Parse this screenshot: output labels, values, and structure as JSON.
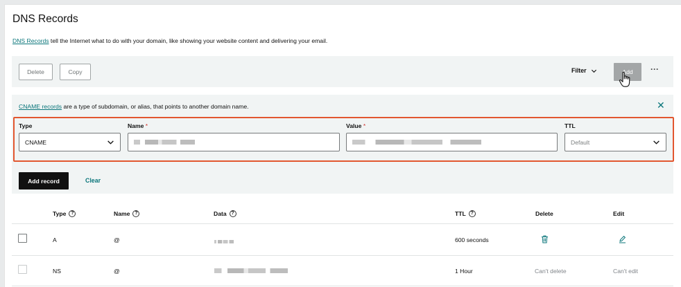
{
  "page": {
    "title": "DNS Records",
    "intro_link": "DNS Records",
    "intro_rest": " tell the Internet what to do with your domain, like showing your website content and delivering your email."
  },
  "toolbar": {
    "delete_label": "Delete",
    "copy_label": "Copy",
    "filter_label": "Filter",
    "add_label": "Add",
    "more_label": "···"
  },
  "info": {
    "link": "CNAME records",
    "rest": " are a type of subdomain, or alias, that points to another domain name."
  },
  "form": {
    "type_label": "Type",
    "type_value": "CNAME",
    "name_label": "Name",
    "value_label": "Value",
    "ttl_label": "TTL",
    "ttl_value": "Default",
    "required_mark": "*",
    "add_record_label": "Add record",
    "clear_label": "Clear"
  },
  "table": {
    "headers": {
      "type": "Type",
      "name": "Name",
      "data": "Data",
      "ttl": "TTL",
      "delete": "Delete",
      "edit": "Edit"
    },
    "rows": [
      {
        "type": "A",
        "name": "@",
        "ttl": "600 seconds",
        "delete": "",
        "edit": ""
      },
      {
        "type": "NS",
        "name": "@",
        "ttl": "1 Hour",
        "delete": "Can't delete",
        "edit": "Can't edit"
      }
    ]
  },
  "colors": {
    "accent": "#09757a",
    "highlight": "#e2562f",
    "primary_button": "#111111",
    "disabled_button": "#a3a6a7"
  }
}
